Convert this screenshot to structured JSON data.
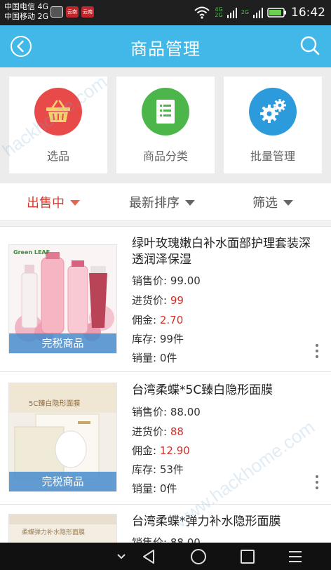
{
  "status_bar": {
    "carrier_1": "中国电信 4G",
    "carrier_2": "中国移动 2G",
    "app_1": "云南",
    "app_2": "云南",
    "net_1": "4G",
    "net_2": "2G",
    "net_3": "2G",
    "time": "16:42",
    "icons": [
      "wifi-icon",
      "signal-icon",
      "battery-icon"
    ]
  },
  "header": {
    "title": "商品管理",
    "back_icon": "back-circle-icon",
    "search_icon": "search-icon"
  },
  "quick_menu": [
    {
      "label": "选品",
      "icon": "basket-icon",
      "color": "#e84a4a"
    },
    {
      "label": "商品分类",
      "icon": "document-list-icon",
      "color": "#4cb64a"
    },
    {
      "label": "批量管理",
      "icon": "gears-icon",
      "color": "#2b9bdc"
    }
  ],
  "filter_tabs": [
    {
      "label": "出售中",
      "active": true
    },
    {
      "label": "最新排序",
      "active": false
    },
    {
      "label": "筛选",
      "active": false
    }
  ],
  "products": [
    {
      "name": "绿叶玫瑰嫩白补水面部护理套装深透润泽保湿",
      "badge": "完税商品",
      "brand_text": "Green LEAF",
      "price_label": "销售价:",
      "price": "99.00",
      "cost_label": "进货价:",
      "cost": "99",
      "commission_label": "佣金:",
      "commission": "2.70",
      "stock_label": "库存:",
      "stock": "99件",
      "sales_label": "销量:",
      "sales": "0件"
    },
    {
      "name": "台湾柔蝶*5C臻白隐形面膜",
      "badge": "完税商品",
      "brand_text": "5C臻白隐形面膜",
      "price_label": "销售价:",
      "price": "88.00",
      "cost_label": "进货价:",
      "cost": "88",
      "commission_label": "佣金:",
      "commission": "12.90",
      "stock_label": "库存:",
      "stock": "53件",
      "sales_label": "销量:",
      "sales": "0件"
    },
    {
      "name": "台湾柔蝶*弹力补水隐形面膜",
      "brand_text": "柔蝶弹力补水隐形面膜",
      "price_label": "销售价:",
      "price": "88.00"
    }
  ],
  "watermark": "www.9ht.com / hackhome.com",
  "watermark_1": "hackhome.com",
  "watermark_2": "www.hackhome.com",
  "nav_bar": [
    "chevron-down-icon",
    "back-triangle-icon",
    "home-circle-icon",
    "recents-square-icon",
    "menu-icon"
  ]
}
